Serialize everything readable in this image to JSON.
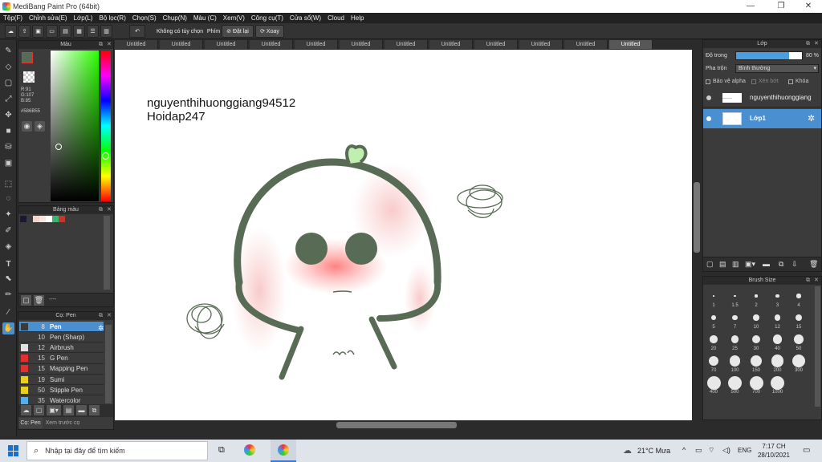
{
  "window": {
    "title": "MediBang Paint Pro (64bit)",
    "minimize": "—",
    "maximize": "❐",
    "close": "✕"
  },
  "menu": [
    "Tệp(F)",
    "Chỉnh sửa(E)",
    "Lớp(L)",
    "Bộ lọc(R)",
    "Chọn(S)",
    "Chụp(N)",
    "Màu (C)",
    "Xem(V)",
    "Công cụ(T)",
    "Cửa sổ(W)",
    "Cloud",
    "Help"
  ],
  "toolbar": {
    "no_selection": "Không có tùy chọn",
    "keys": "Phím",
    "reset": "Đặt lại",
    "rotate": "Xoay"
  },
  "color_panel": {
    "title": "Màu",
    "r": "R:91",
    "g": "G:107",
    "b": "B:85",
    "hex": "#586B55",
    "fg_color": "#586b55",
    "bg_color": "#000000"
  },
  "palette_panel": {
    "title": "Bảng màu",
    "value": "----",
    "swatches": [
      "#1a1a2e",
      "#3a3a3a",
      "#f2d6c9",
      "#f5e6e0",
      "#ffffff",
      "#3cb371",
      "#c0392b"
    ]
  },
  "brush_panel": {
    "title": "Cọ: Pen",
    "brushes": [
      {
        "size": "8",
        "name": "Pen",
        "color": "#3a3a3a"
      },
      {
        "size": "10",
        "name": "Pen (Sharp)",
        "color": "#3a3a3a"
      },
      {
        "size": "12",
        "name": "Airbrush",
        "color": "#e0e0e0"
      },
      {
        "size": "15",
        "name": "G Pen",
        "color": "#e03030"
      },
      {
        "size": "15",
        "name": "Mapping Pen",
        "color": "#e03030"
      },
      {
        "size": "19",
        "name": "Sumi",
        "color": "#e8d020"
      },
      {
        "size": "50",
        "name": "Stipple Pen",
        "color": "#e8d020"
      },
      {
        "size": "35",
        "name": "Watercolor",
        "color": "#50b0f0"
      }
    ],
    "bottom_tabs": [
      "Cọ: Pen",
      "Xem trước cọ"
    ]
  },
  "tabs": [
    "Untitled",
    "Untitled",
    "Untitled",
    "Untitled",
    "Untitled",
    "Untitled",
    "Untitled",
    "Untitled",
    "Untitled",
    "Untitled",
    "Untitled",
    "Untitled"
  ],
  "canvas_text": {
    "line1": "nguyenthihuonggiang94512",
    "line2": "Hoidap247"
  },
  "layer_panel": {
    "title": "Lớp",
    "opacity_label": "Độ trong",
    "opacity_value": "80 %",
    "opacity_fraction": 0.8,
    "blend_label": "Pha trộn",
    "blend_value": "Bình thường",
    "protect_alpha": "Bảo vệ alpha",
    "clipping": "Xén bớt",
    "lock": "Khóa",
    "layers": [
      {
        "name": "nguyenthihuonggiang"
      },
      {
        "name": "Lớp1"
      }
    ]
  },
  "brush_size_panel": {
    "title": "Brush Size",
    "sizes": [
      "1",
      "1.5",
      "2",
      "3",
      "4",
      "5",
      "7",
      "10",
      "12",
      "15",
      "20",
      "25",
      "30",
      "40",
      "50",
      "70",
      "100",
      "150",
      "200",
      "300",
      "400",
      "500",
      "700",
      "1000"
    ]
  },
  "taskbar": {
    "search_placeholder": "Nhập tại đây để tìm kiếm",
    "weather": "21°C Mưa",
    "language": "ENG",
    "time": "7:17 CH",
    "date": "28/10/2021"
  }
}
